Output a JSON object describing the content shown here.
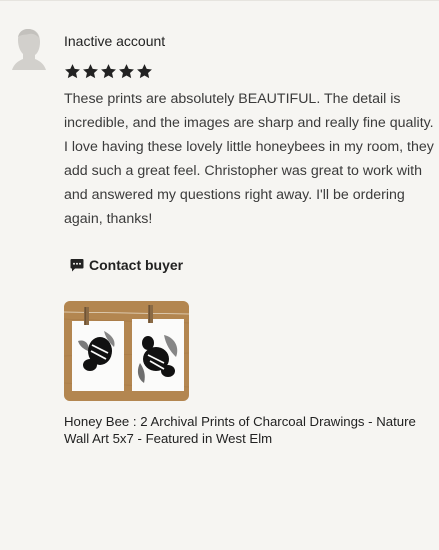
{
  "review": {
    "author": "Inactive account",
    "rating": 5,
    "rating_max": 5,
    "text": "These prints are absolutely BEAUTIFUL. The detail is incredible, and the images are sharp and really fine quality. I love having these lovely little honeybees in my room, they add such a great feel. Christopher was great to work with and answered my questions right away. I'll be ordering again, thanks!",
    "contact_label": "Contact buyer"
  },
  "product": {
    "title": "Honey Bee : 2 Archival Prints of Charcoal Drawings - Nature Wall Art 5x7 - Featured in West Elm"
  },
  "colors": {
    "background": "#f6f5f2",
    "star": "#222222",
    "text": "#222222"
  },
  "icons": {
    "avatar": "avatar-placeholder-icon",
    "star": "star-icon",
    "contact": "speech-bubble-icon"
  }
}
